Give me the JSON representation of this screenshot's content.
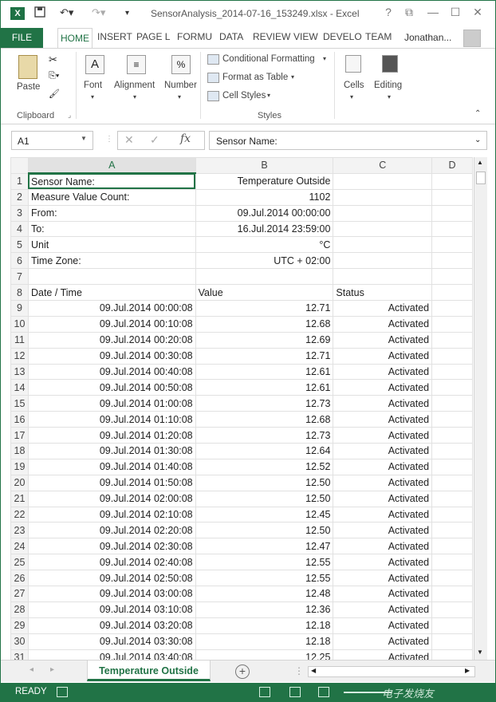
{
  "titlebar": {
    "app_icon": "X",
    "title": "SensorAnalysis_2014-07-16_153249.xlsx - Excel",
    "help": "?",
    "restore": "⧉",
    "minimize": "—",
    "maximize": "☐",
    "close": "✕"
  },
  "tabs": {
    "file": "FILE",
    "home": "HOME",
    "insert": "INSERT",
    "page_layout": "PAGE L",
    "formulas": "FORMU",
    "data": "DATA",
    "review": "REVIEW",
    "view": "VIEW",
    "developer": "DEVELO",
    "team": "TEAM",
    "user": "Jonathan..."
  },
  "ribbon": {
    "paste": "Paste",
    "clipboard": "Clipboard",
    "font": "Font",
    "alignment": "Alignment",
    "number": "Number",
    "number_icon": "%",
    "conditional_formatting": "Conditional Formatting",
    "format_as_table": "Format as Table",
    "cell_styles": "Cell Styles",
    "styles": "Styles",
    "cells": "Cells",
    "editing": "Editing"
  },
  "formula_bar": {
    "name_box": "A1",
    "fx": "fx",
    "formula": "Sensor Name:"
  },
  "columns": [
    "A",
    "B",
    "C",
    "D"
  ],
  "header_rows": [
    [
      "1",
      "Sensor Name:",
      "Temperature Outside",
      "",
      ""
    ],
    [
      "2",
      "Measure Value Count:",
      "1102",
      "",
      ""
    ],
    [
      "3",
      "From:",
      "09.Jul.2014 00:00:00",
      "",
      ""
    ],
    [
      "4",
      "To:",
      "16.Jul.2014 23:59:00",
      "",
      ""
    ],
    [
      "5",
      "Unit",
      "°C",
      "",
      ""
    ],
    [
      "6",
      "Time Zone:",
      "UTC + 02:00",
      "",
      ""
    ],
    [
      "7",
      "",
      "",
      "",
      ""
    ],
    [
      "8",
      "Date / Time",
      "Value",
      "Status",
      ""
    ]
  ],
  "data_rows": [
    [
      "9",
      "09.Jul.2014 00:00:08",
      "12.71",
      "Activated"
    ],
    [
      "10",
      "09.Jul.2014 00:10:08",
      "12.68",
      "Activated"
    ],
    [
      "11",
      "09.Jul.2014 00:20:08",
      "12.69",
      "Activated"
    ],
    [
      "12",
      "09.Jul.2014 00:30:08",
      "12.71",
      "Activated"
    ],
    [
      "13",
      "09.Jul.2014 00:40:08",
      "12.61",
      "Activated"
    ],
    [
      "14",
      "09.Jul.2014 00:50:08",
      "12.61",
      "Activated"
    ],
    [
      "15",
      "09.Jul.2014 01:00:08",
      "12.73",
      "Activated"
    ],
    [
      "16",
      "09.Jul.2014 01:10:08",
      "12.68",
      "Activated"
    ],
    [
      "17",
      "09.Jul.2014 01:20:08",
      "12.73",
      "Activated"
    ],
    [
      "18",
      "09.Jul.2014 01:30:08",
      "12.64",
      "Activated"
    ],
    [
      "19",
      "09.Jul.2014 01:40:08",
      "12.52",
      "Activated"
    ],
    [
      "20",
      "09.Jul.2014 01:50:08",
      "12.50",
      "Activated"
    ],
    [
      "21",
      "09.Jul.2014 02:00:08",
      "12.50",
      "Activated"
    ],
    [
      "22",
      "09.Jul.2014 02:10:08",
      "12.45",
      "Activated"
    ],
    [
      "23",
      "09.Jul.2014 02:20:08",
      "12.50",
      "Activated"
    ],
    [
      "24",
      "09.Jul.2014 02:30:08",
      "12.47",
      "Activated"
    ],
    [
      "25",
      "09.Jul.2014 02:40:08",
      "12.55",
      "Activated"
    ],
    [
      "26",
      "09.Jul.2014 02:50:08",
      "12.55",
      "Activated"
    ],
    [
      "27",
      "09.Jul.2014 03:00:08",
      "12.48",
      "Activated"
    ],
    [
      "28",
      "09.Jul.2014 03:10:08",
      "12.36",
      "Activated"
    ],
    [
      "29",
      "09.Jul.2014 03:20:08",
      "12.18",
      "Activated"
    ],
    [
      "30",
      "09.Jul.2014 03:30:08",
      "12.18",
      "Activated"
    ],
    [
      "31",
      "09.Jul.2014 03:40:08",
      "12.25",
      "Activated"
    ]
  ],
  "sheet_tabs": {
    "active": "Temperature Outside",
    "add": "+"
  },
  "status": {
    "ready": "READY",
    "watermark": "电子发烧友"
  },
  "colors": {
    "accent": "#217346"
  }
}
